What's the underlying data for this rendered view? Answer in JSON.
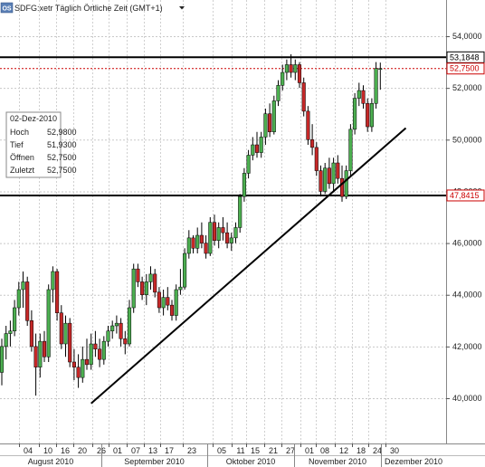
{
  "header": {
    "badge": "OS",
    "title": "SDFG:xetr Täglich Örtliche Zeit (GMT+1)",
    "dropdown_icon": "caret-down-icon"
  },
  "info_box": {
    "date": "02-Dez-2010",
    "rows": [
      {
        "label": "Hoch",
        "value": "52,9800"
      },
      {
        "label": "Tief",
        "value": "51,9300"
      },
      {
        "label": "Öffnen",
        "value": "52,7500"
      },
      {
        "label": "Zuletzt",
        "value": "52,7500"
      }
    ]
  },
  "chart_data": {
    "type": "candlestick",
    "ylim": [
      38.0,
      55.0
    ],
    "yticks": [
      {
        "value": 40,
        "label": "40,0000"
      },
      {
        "value": 42,
        "label": "42,0000"
      },
      {
        "value": 44,
        "label": "44,0000"
      },
      {
        "value": 46,
        "label": "46,0000"
      },
      {
        "value": 48,
        "label": "48,0000"
      },
      {
        "value": 50,
        "label": "50,0000"
      },
      {
        "value": 52,
        "label": "52,0000"
      },
      {
        "value": 54,
        "label": "54,0000"
      }
    ],
    "day_ticks": [
      "04",
      "10",
      "16",
      "20",
      "26",
      "01",
      "07",
      "13",
      "17",
      "23",
      "05",
      "11",
      "15",
      "21",
      "27",
      "01",
      "08",
      "12",
      "18",
      "24",
      "30"
    ],
    "months": [
      "August 2010",
      "September 2010",
      "Oktober 2010",
      "November 2010",
      "Dezember 2010"
    ],
    "price_tags": [
      {
        "value": 53.1848,
        "label": "53,1848",
        "color": "#000000"
      },
      {
        "value": 52.75,
        "label": "52,7500",
        "color": "#cc0000"
      },
      {
        "value": 47.8415,
        "label": "47,8415",
        "color": "#cc0000"
      }
    ],
    "horizontal_lines": [
      53.1848,
      47.8415
    ],
    "current_price_line": 52.75,
    "trend_line": {
      "from": [
        21,
        39.8
      ],
      "to": [
        95,
        50.45
      ]
    },
    "candles": [
      [
        0,
        41.0,
        42.3,
        40.5,
        42.0
      ],
      [
        1,
        42.0,
        42.8,
        41.5,
        42.5
      ],
      [
        2,
        42.5,
        43.0,
        42.0,
        42.6
      ],
      [
        3,
        42.6,
        43.8,
        42.4,
        43.5
      ],
      [
        4,
        43.5,
        44.5,
        43.2,
        44.2
      ],
      [
        5,
        44.2,
        44.9,
        43.5,
        44.5
      ],
      [
        6,
        44.5,
        44.7,
        42.8,
        43.0
      ],
      [
        7,
        43.0,
        43.4,
        41.8,
        42.0
      ],
      [
        8,
        42.0,
        42.5,
        40.1,
        41.2
      ],
      [
        9,
        41.2,
        42.5,
        40.8,
        42.2
      ],
      [
        10,
        42.2,
        42.6,
        41.4,
        41.6
      ],
      [
        11,
        41.6,
        44.4,
        41.4,
        44.2
      ],
      [
        12,
        44.2,
        45.1,
        43.7,
        44.9
      ],
      [
        13,
        44.9,
        45.0,
        43.0,
        43.3
      ],
      [
        14,
        43.3,
        43.6,
        41.9,
        42.1
      ],
      [
        15,
        42.1,
        43.2,
        41.6,
        42.9
      ],
      [
        16,
        42.9,
        43.1,
        41.2,
        41.4
      ],
      [
        17,
        41.4,
        41.9,
        40.7,
        41.2
      ],
      [
        18,
        41.2,
        41.7,
        40.4,
        40.8
      ],
      [
        19,
        40.8,
        42.0,
        40.6,
        41.5
      ],
      [
        20,
        41.5,
        42.3,
        41.1,
        41.3
      ],
      [
        21,
        41.3,
        42.5,
        41.1,
        42.1
      ],
      [
        22,
        42.1,
        42.6,
        41.6,
        41.9
      ],
      [
        23,
        41.9,
        42.3,
        41.2,
        41.5
      ],
      [
        24,
        41.5,
        42.4,
        41.3,
        42.2
      ],
      [
        25,
        42.2,
        42.8,
        42.0,
        42.6
      ],
      [
        26,
        42.6,
        43.0,
        42.3,
        42.8
      ],
      [
        27,
        42.8,
        43.2,
        42.5,
        42.9
      ],
      [
        28,
        42.9,
        43.1,
        42.0,
        42.3
      ],
      [
        29,
        42.3,
        42.6,
        41.7,
        42.1
      ],
      [
        30,
        42.1,
        43.8,
        42.0,
        43.5
      ],
      [
        31,
        43.5,
        45.2,
        43.3,
        45.0
      ],
      [
        32,
        45.0,
        45.2,
        44.3,
        44.5
      ],
      [
        33,
        44.5,
        44.7,
        43.8,
        44.0
      ],
      [
        34,
        44.0,
        44.8,
        43.6,
        44.5
      ],
      [
        35,
        44.5,
        45.1,
        44.2,
        44.8
      ],
      [
        36,
        44.8,
        45.0,
        43.9,
        44.1
      ],
      [
        37,
        44.1,
        44.3,
        43.3,
        43.5
      ],
      [
        38,
        43.5,
        44.2,
        43.2,
        43.9
      ],
      [
        39,
        43.9,
        44.3,
        43.4,
        43.6
      ],
      [
        40,
        43.6,
        43.8,
        43.0,
        43.2
      ],
      [
        41,
        43.2,
        44.4,
        43.0,
        44.2
      ],
      [
        42,
        44.2,
        45.0,
        44.0,
        44.3
      ],
      [
        43,
        44.3,
        45.8,
        44.2,
        45.6
      ],
      [
        44,
        45.6,
        46.5,
        45.4,
        46.2
      ],
      [
        45,
        46.2,
        46.3,
        45.6,
        45.8
      ],
      [
        46,
        45.8,
        46.6,
        45.6,
        46.3
      ],
      [
        47,
        46.3,
        46.8,
        45.8,
        46.0
      ],
      [
        48,
        46.0,
        46.3,
        45.4,
        45.6
      ],
      [
        49,
        45.6,
        47.0,
        45.5,
        46.8
      ],
      [
        50,
        46.8,
        47.1,
        45.9,
        46.1
      ],
      [
        51,
        46.1,
        46.8,
        45.8,
        46.6
      ],
      [
        52,
        46.6,
        47.0,
        46.1,
        46.4
      ],
      [
        53,
        46.4,
        46.8,
        45.8,
        46.0
      ],
      [
        54,
        46.0,
        46.4,
        45.7,
        46.2
      ],
      [
        55,
        46.2,
        46.8,
        46.0,
        46.6
      ],
      [
        56,
        46.6,
        47.9,
        46.4,
        47.8
      ],
      [
        57,
        47.8,
        48.9,
        47.6,
        48.7
      ],
      [
        58,
        48.7,
        49.6,
        48.5,
        49.4
      ],
      [
        59,
        49.4,
        50.1,
        49.2,
        49.8
      ],
      [
        60,
        49.8,
        50.3,
        49.3,
        49.5
      ],
      [
        61,
        49.5,
        50.3,
        49.3,
        50.1
      ],
      [
        62,
        50.1,
        51.2,
        49.8,
        51.0
      ],
      [
        63,
        51.0,
        51.4,
        50.1,
        50.3
      ],
      [
        64,
        50.3,
        51.7,
        50.2,
        51.5
      ],
      [
        65,
        51.5,
        52.3,
        51.3,
        52.1
      ],
      [
        66,
        52.1,
        52.9,
        51.9,
        52.6
      ],
      [
        67,
        52.6,
        53.1,
        52.3,
        52.9
      ],
      [
        68,
        52.9,
        53.3,
        52.4,
        52.6
      ],
      [
        69,
        52.6,
        53.1,
        52.3,
        52.9
      ],
      [
        70,
        52.9,
        53.0,
        52.0,
        52.2
      ],
      [
        71,
        52.2,
        52.4,
        50.9,
        51.1
      ],
      [
        72,
        51.1,
        51.3,
        49.8,
        50.0
      ],
      [
        73,
        50.0,
        50.6,
        49.4,
        49.7
      ],
      [
        74,
        49.7,
        49.9,
        48.6,
        48.8
      ],
      [
        75,
        48.8,
        49.0,
        47.8,
        48.0
      ],
      [
        76,
        48.0,
        49.1,
        47.9,
        48.9
      ],
      [
        77,
        48.9,
        49.3,
        48.1,
        48.3
      ],
      [
        78,
        48.3,
        49.3,
        48.0,
        49.1
      ],
      [
        79,
        49.1,
        49.4,
        48.3,
        48.5
      ],
      [
        80,
        48.5,
        49.0,
        47.6,
        47.8
      ],
      [
        81,
        47.8,
        49.0,
        47.7,
        48.8
      ],
      [
        82,
        48.8,
        50.6,
        48.6,
        50.4
      ],
      [
        83,
        50.4,
        51.8,
        50.2,
        51.6
      ],
      [
        84,
        51.6,
        52.2,
        51.3,
        51.9
      ],
      [
        85,
        51.9,
        52.1,
        51.2,
        51.4
      ],
      [
        86,
        51.4,
        51.6,
        50.3,
        50.5
      ],
      [
        87,
        50.5,
        51.6,
        50.3,
        51.4
      ],
      [
        88,
        51.4,
        53.0,
        51.2,
        52.75
      ],
      [
        89,
        52.75,
        52.98,
        51.93,
        52.75
      ]
    ]
  }
}
